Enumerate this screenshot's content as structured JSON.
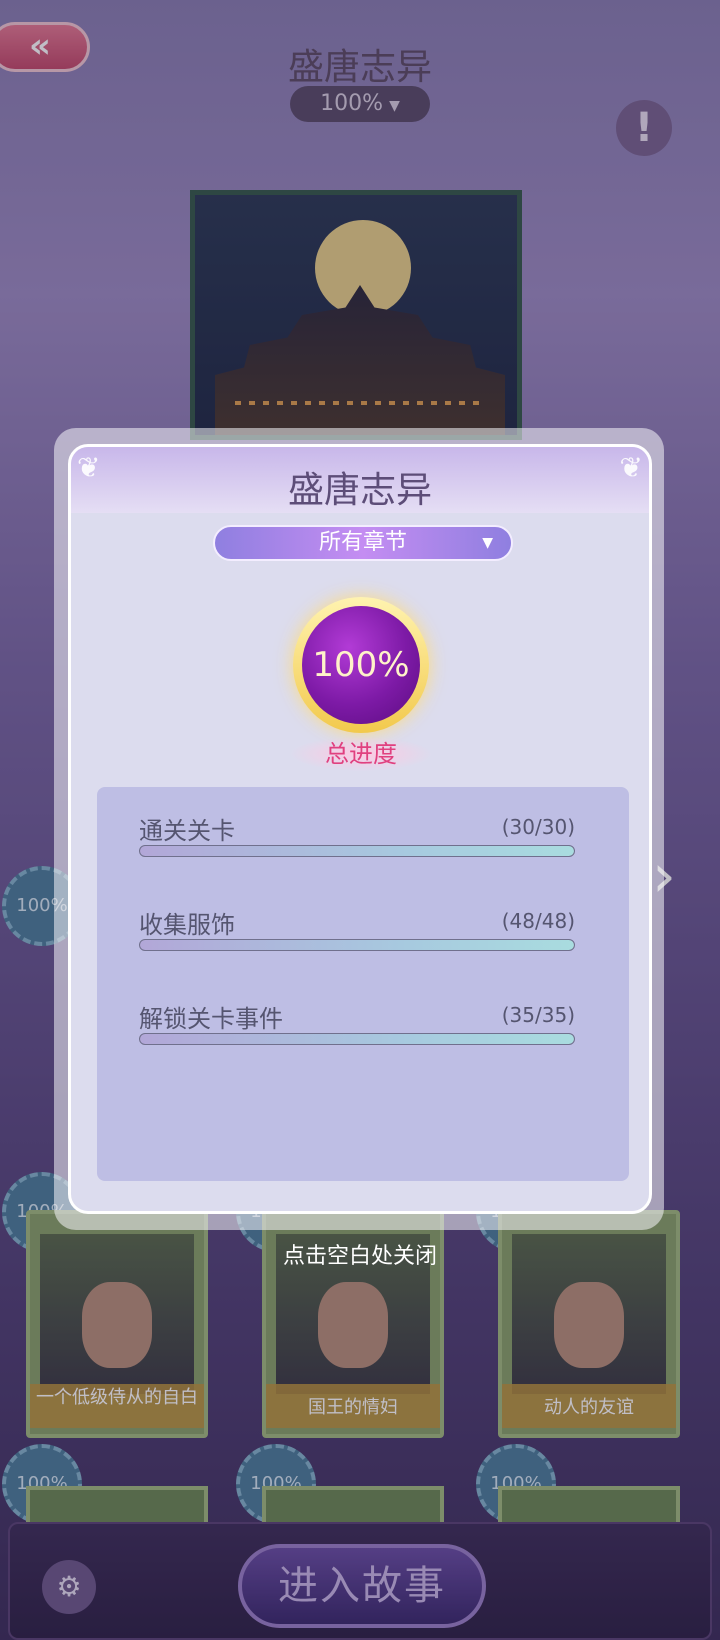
{
  "header": {
    "back_icon": "double-chevron-left-icon",
    "title": "盛唐志异",
    "progress_pill": "100%",
    "info_icon": "exclamation-icon"
  },
  "cards": {
    "badge_text": "100%",
    "row2": [
      {
        "caption": "一个低级侍从的自白"
      },
      {
        "caption": "国王的情妇"
      },
      {
        "caption": "动人的友谊"
      }
    ]
  },
  "footer": {
    "enter_label": "进入故事",
    "settings_icon": "book-gear-icon"
  },
  "modal": {
    "title": "盛唐志异",
    "chapter_select": "所有章节",
    "overall_percent": "100%",
    "overall_label": "总进度",
    "stats": [
      {
        "label": "通关关卡",
        "count": "(30/30)",
        "progress": 1.0
      },
      {
        "label": "收集服饰",
        "count": "(48/48)",
        "progress": 1.0
      },
      {
        "label": "解锁关卡事件",
        "count": "(35/35)",
        "progress": 1.0
      }
    ],
    "close_hint": "点击空白处关闭"
  }
}
